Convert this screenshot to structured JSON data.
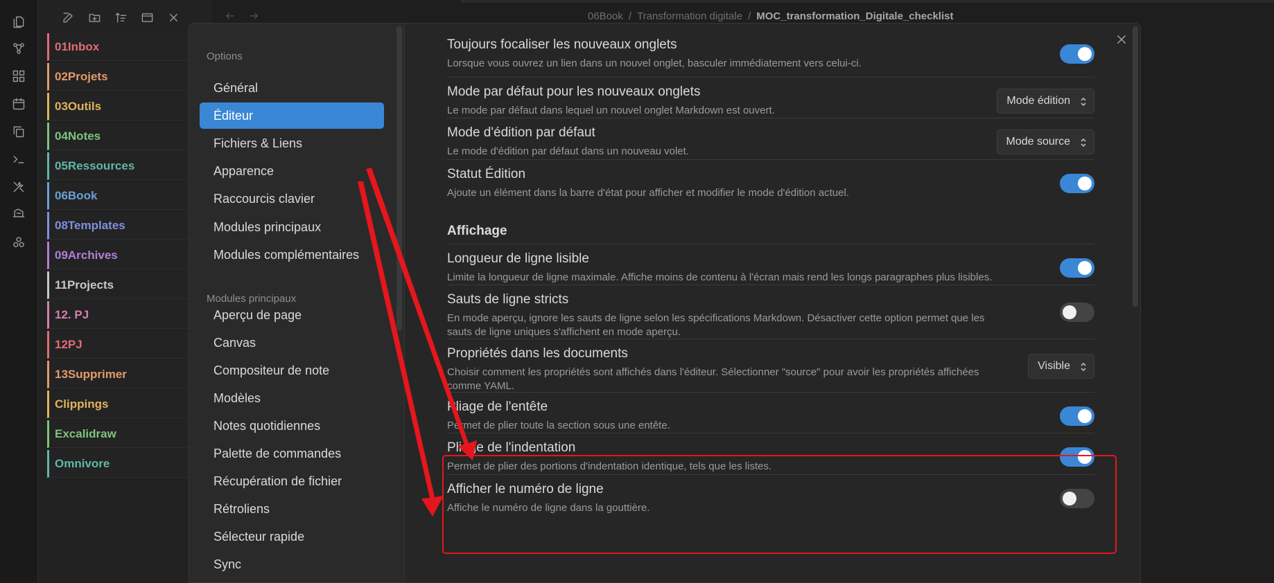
{
  "ribbon": {
    "icons": [
      "files-icon",
      "graph-icon",
      "canvas-grid-icon",
      "calendar-icon",
      "copy-icon",
      "terminal-icon",
      "tools-icon",
      "slides-icon",
      "network-icon"
    ]
  },
  "explorer": {
    "toolbar_icons": [
      "new-note-icon",
      "new-folder-icon",
      "sort-icon",
      "collapse-icon",
      "close-x-icon"
    ],
    "folders": [
      {
        "label": "01Inbox",
        "color": "#e06c75"
      },
      {
        "label": "02Projets",
        "color": "#e39a6b"
      },
      {
        "label": "03Outils",
        "color": "#e0b35c"
      },
      {
        "label": "04Notes",
        "color": "#7fc27f"
      },
      {
        "label": "05Ressources",
        "color": "#5fb8a8"
      },
      {
        "label": "06Book",
        "color": "#6aa0d8"
      },
      {
        "label": "08Templates",
        "color": "#7f8fe0"
      },
      {
        "label": "09Archives",
        "color": "#b07fd8"
      },
      {
        "label": "11Projects",
        "color": "#c8c8c8"
      },
      {
        "label": "12. PJ",
        "color": "#d47fb0"
      },
      {
        "label": "12PJ",
        "color": "#e06c75"
      },
      {
        "label": "13Supprimer",
        "color": "#e39a6b"
      },
      {
        "label": "Clippings",
        "color": "#e0b35c"
      },
      {
        "label": "Excalidraw",
        "color": "#7fc27f"
      },
      {
        "label": "Omnivore",
        "color": "#5fb8a8"
      }
    ]
  },
  "topbar": {
    "breadcrumb": [
      "06Book",
      "Transformation digitale"
    ],
    "breadcrumb_sep": "/",
    "current": "MOC_transformation_Digitale_checklist"
  },
  "sidebar": {
    "options_heading": "Options",
    "options": [
      {
        "label": "Général",
        "active": false
      },
      {
        "label": "Éditeur",
        "active": true
      },
      {
        "label": "Fichiers & Liens",
        "active": false
      },
      {
        "label": "Apparence",
        "active": false
      },
      {
        "label": "Raccourcis clavier",
        "active": false
      },
      {
        "label": "Modules principaux",
        "active": false
      },
      {
        "label": "Modules complémentaires",
        "active": false
      }
    ],
    "modules_heading": "Modules principaux",
    "modules": [
      {
        "label": "Aperçu de page"
      },
      {
        "label": "Canvas"
      },
      {
        "label": "Compositeur de note"
      },
      {
        "label": "Modèles"
      },
      {
        "label": "Notes quotidiennes"
      },
      {
        "label": "Palette de commandes"
      },
      {
        "label": "Récupération de fichier"
      },
      {
        "label": "Rétroliens"
      },
      {
        "label": "Sélecteur rapide"
      },
      {
        "label": "Sync"
      }
    ]
  },
  "settings": {
    "items": [
      {
        "name": "Toujours focaliser les nouveaux onglets",
        "desc": "Lorsque vous ouvrez un lien dans un nouvel onglet, basculer immédiatement vers celui-ci.",
        "control": "toggle",
        "on": true
      },
      {
        "name": "Mode par défaut pour les nouveaux onglets",
        "desc": "Le mode par défaut dans lequel un nouvel onglet Markdown est ouvert.",
        "control": "dropdown",
        "value": "Mode édition"
      },
      {
        "name": "Mode d'édition par défaut",
        "desc": "Le mode d'édition par défaut dans un nouveau volet.",
        "control": "dropdown",
        "value": "Mode source"
      },
      {
        "name": "Statut Édition",
        "desc": "Ajoute un élément dans la barre d'état pour afficher et modifier le mode d'édition actuel.",
        "control": "toggle",
        "on": true
      }
    ],
    "section_affichage": "Affichage",
    "display_items": [
      {
        "name": "Longueur de ligne lisible",
        "desc": "Limite la longueur de ligne maximale. Affiche moins de contenu à l'écran mais rend les longs paragraphes plus lisibles.",
        "control": "toggle",
        "on": true
      },
      {
        "name": "Sauts de ligne stricts",
        "desc": "En mode aperçu, ignore les sauts de ligne selon les spécifications Markdown. Désactiver cette option permet que les sauts de ligne uniques s'affichent en mode aperçu.",
        "control": "toggle",
        "on": false
      },
      {
        "name": "Propriétés dans les documents",
        "desc": "Choisir comment les propriétés sont affichés dans l'éditeur. Sélectionner \"source\" pour avoir les propriétés affichées comme YAML.",
        "control": "dropdown",
        "value": "Visible"
      },
      {
        "name": "Pliage de l'entête",
        "desc": "Permet de plier toute la section sous une entête.",
        "control": "toggle",
        "on": true
      },
      {
        "name": "Pliage de l'indentation",
        "desc": "Permet de plier des portions d'indentation identique, tels que les listes.",
        "control": "toggle",
        "on": true
      },
      {
        "name": "Afficher le numéro de ligne",
        "desc": "Affiche le numéro de ligne dans la gouttière.",
        "control": "toggle",
        "on": false
      }
    ]
  },
  "colors": {
    "accent": "#3a87d6",
    "annotation_red": "#e5161d"
  }
}
